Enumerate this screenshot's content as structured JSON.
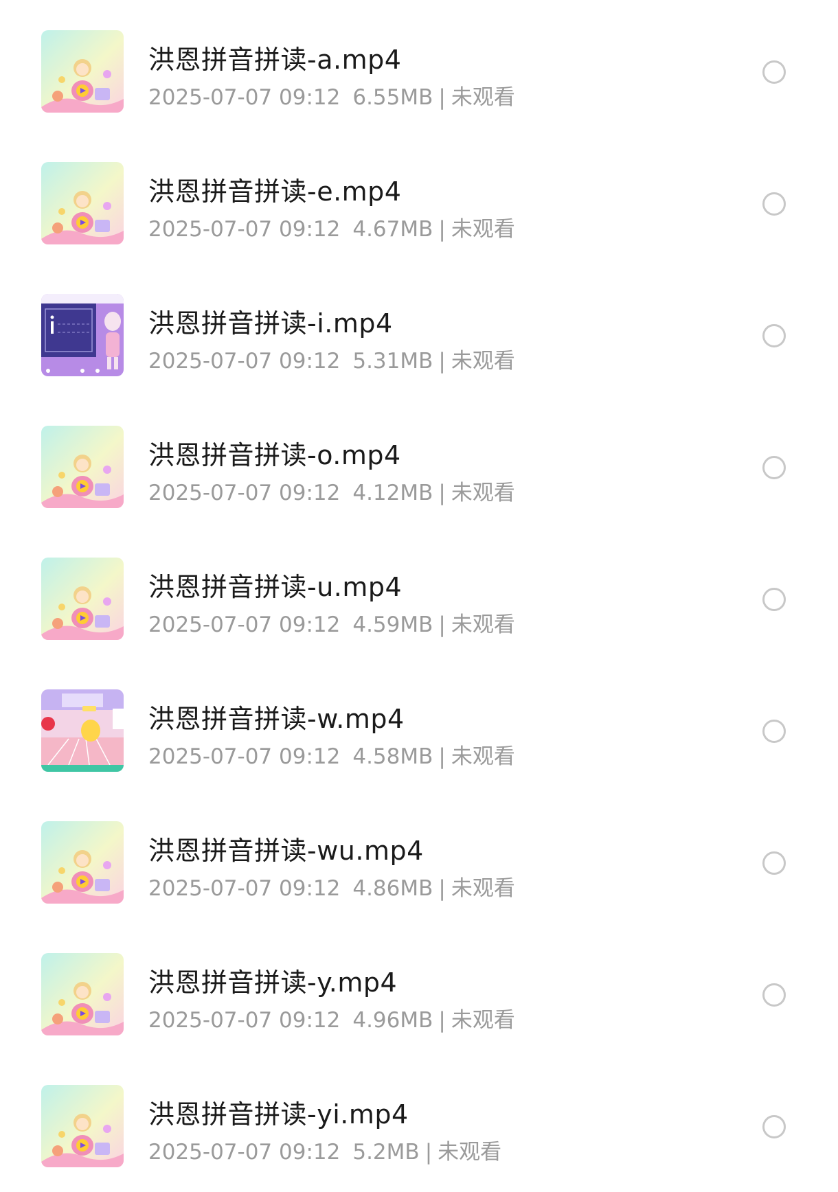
{
  "files": [
    {
      "title": "洪恩拼音拼读-a.mp4",
      "date": "2025-07-07 09:12",
      "size": "6.55MB",
      "status": "未观看",
      "thumb": "character-thumbnail",
      "selected": false
    },
    {
      "title": "洪恩拼音拼读-e.mp4",
      "date": "2025-07-07 09:12",
      "size": "4.67MB",
      "status": "未观看",
      "thumb": "character-thumbnail",
      "selected": false
    },
    {
      "title": "洪恩拼音拼读-i.mp4",
      "date": "2025-07-07 09:12",
      "size": "5.31MB",
      "status": "未观看",
      "thumb": "board-thumbnail",
      "selected": false
    },
    {
      "title": "洪恩拼音拼读-o.mp4",
      "date": "2025-07-07 09:12",
      "size": "4.12MB",
      "status": "未观看",
      "thumb": "character-thumbnail",
      "selected": false
    },
    {
      "title": "洪恩拼音拼读-u.mp4",
      "date": "2025-07-07 09:12",
      "size": "4.59MB",
      "status": "未观看",
      "thumb": "character-thumbnail",
      "selected": false
    },
    {
      "title": "洪恩拼音拼读-w.mp4",
      "date": "2025-07-07 09:12",
      "size": "4.58MB",
      "status": "未观看",
      "thumb": "room-thumbnail",
      "selected": false
    },
    {
      "title": "洪恩拼音拼读-wu.mp4",
      "date": "2025-07-07 09:12",
      "size": "4.86MB",
      "status": "未观看",
      "thumb": "character-thumbnail",
      "selected": false
    },
    {
      "title": "洪恩拼音拼读-y.mp4",
      "date": "2025-07-07 09:12",
      "size": "4.96MB",
      "status": "未观看",
      "thumb": "character-thumbnail",
      "selected": false
    },
    {
      "title": "洪恩拼音拼读-yi.mp4",
      "date": "2025-07-07 09:12",
      "size": "5.2MB",
      "status": "未观看",
      "thumb": "character-thumbnail",
      "selected": false
    }
  ],
  "separator": "|",
  "colors": {
    "title": "#1a1a1a",
    "meta": "#9a9a9a",
    "select_ring": "#c8c8c8"
  }
}
